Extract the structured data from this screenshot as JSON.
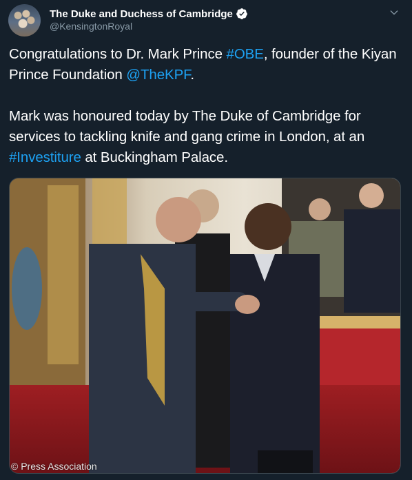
{
  "author": {
    "display_name": "The Duke and Duchess of Cambridge",
    "handle": "@KensingtonRoyal",
    "verified": true
  },
  "tweet": {
    "p1_a": "Congratulations to Dr. Mark Prince ",
    "p1_hashtag": "#OBE",
    "p1_b": ", founder of the Kiyan Prince Foundation ",
    "p1_mention": "@TheKPF",
    "p1_c": ".",
    "p2_a": "Mark was honoured today by The Duke of Cambridge for services to tackling knife and gang crime in London, at an ",
    "p2_hashtag": "#Investiture",
    "p2_b": " at Buckingham Palace."
  },
  "media": {
    "credit": "© Press Association"
  },
  "icons": {
    "verified": "verified-badge-icon",
    "more": "chevron-down-icon"
  },
  "colors": {
    "background": "#15202b",
    "link": "#1da1f2",
    "secondary_text": "#8899a6"
  }
}
